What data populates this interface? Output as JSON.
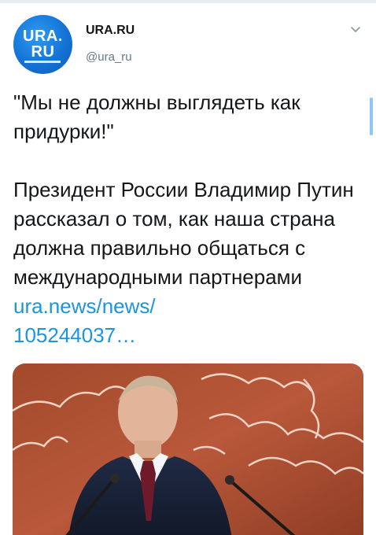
{
  "account": {
    "avatar_line1": "URA.",
    "avatar_line2": "RU",
    "display_name": "URA.RU",
    "handle": "@ura_ru"
  },
  "tweet": {
    "quote": "\"Мы не должны выглядеть как придурки!\"",
    "body": "Президент России Владимир Путин рассказал о том, как наша страна должна правильно общаться с международными партнерами",
    "link_text": "ura.news/news/\n105244037…"
  },
  "icons": {
    "menu": "chevron-down-icon"
  },
  "colors": {
    "link": "#1b95e0",
    "text": "#14171a",
    "secondary": "#657786",
    "avatar_bg": "#1473d6"
  }
}
